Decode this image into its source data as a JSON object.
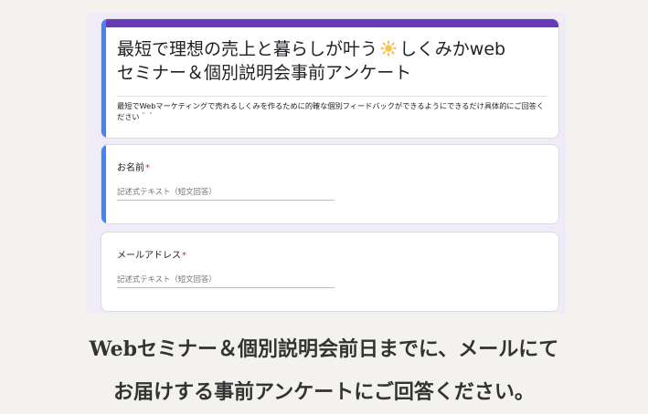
{
  "form": {
    "title_part1": "最短で理想の売上と暮らしが叶う",
    "title_icon": "sun-icon",
    "title_part2": "しくみかweb",
    "title_line2": "セミナー＆個別説明会事前アンケート",
    "description": "最短でWebマーケティングで売れるしくみを作るために的確な個別フィードバックができるようにできるだけ具体的にご回答ください＾＾",
    "accent_color": "#673ab7",
    "focus_color": "#4285f4",
    "background_color": "#f0ebf8"
  },
  "questions": [
    {
      "label": "お名前",
      "required_mark": "*",
      "placeholder": "記述式テキスト（短文回答）"
    },
    {
      "label": "メールアドレス",
      "required_mark": "*",
      "placeholder": "記述式テキスト（短文回答）"
    }
  ],
  "caption": {
    "line1": "Webセミナー＆個別説明会前日までに、メールにて",
    "line2": "お届けする事前アンケートにご回答ください。"
  }
}
